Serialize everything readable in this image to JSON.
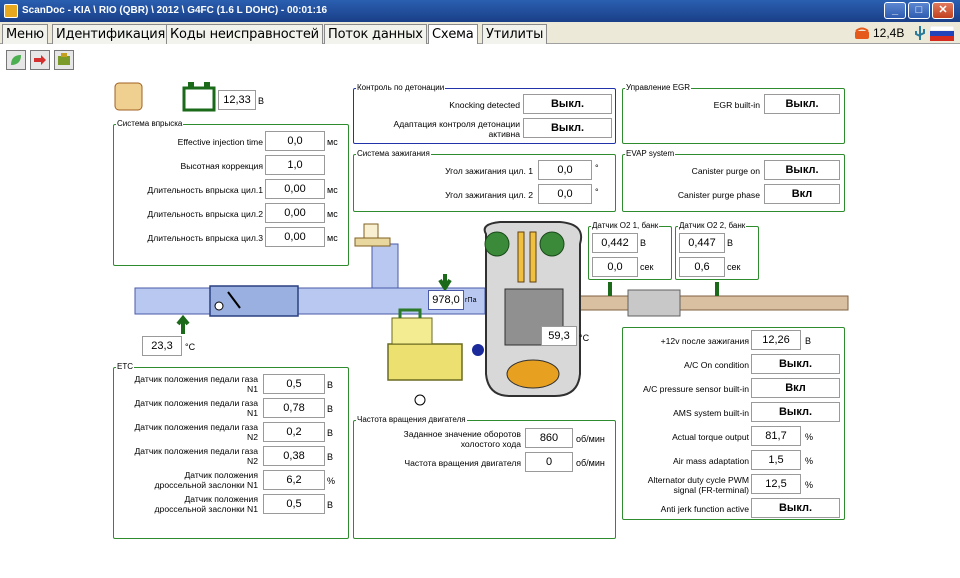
{
  "window": {
    "title": "ScanDoc - KIA \\ RIO (QBR) \\ 2012 \\ G4FC (1.6 L DOHC) - 00:01:16",
    "min": "_",
    "max": "□",
    "close": "✕"
  },
  "tabs": [
    "Меню",
    "Идентификация",
    "Коды неисправностей",
    "Поток данных",
    "Схема",
    "Утилиты"
  ],
  "status": {
    "voltage": "12,4В"
  },
  "battery": {
    "value": "12,33",
    "unit": "В"
  },
  "injection": {
    "title": "Система впрыска",
    "rows": [
      {
        "label": "Effective injection time",
        "value": "0,0",
        "unit": "мс"
      },
      {
        "label": "Высотная коррекция",
        "value": "1,0",
        "unit": ""
      },
      {
        "label": "Длительность впрыска цил.1",
        "value": "0,00",
        "unit": "мс"
      },
      {
        "label": "Длительность впрыска цил.2",
        "value": "0,00",
        "unit": "мс"
      },
      {
        "label": "Длительность впрыска цил.3",
        "value": "0,00",
        "unit": "мс"
      }
    ]
  },
  "knock": {
    "title": "Контроль по детонации",
    "rows": [
      {
        "label": "Knocking detected",
        "value": "Выкл."
      },
      {
        "label1": "Адаптация контроля детонации",
        "label2": "активна",
        "value": "Выкл."
      }
    ]
  },
  "ignition": {
    "title": "Система зажигания",
    "rows": [
      {
        "label": "Угол зажигания цил. 1",
        "value": "0,0",
        "unit": "°"
      },
      {
        "label": "Угол зажигания цил. 2",
        "value": "0,0",
        "unit": "°"
      }
    ]
  },
  "egr": {
    "title": "Управление EGR",
    "label": "EGR built-in",
    "value": "Выкл."
  },
  "evap": {
    "title": "EVAP system",
    "rows": [
      {
        "label": "Canister purge on",
        "value": "Выкл."
      },
      {
        "label": "Canister purge phase",
        "value": "Вкл"
      }
    ]
  },
  "o2_1": {
    "title": "Датчик O2 1, банк",
    "volt": "0,442",
    "volt_unit": "В",
    "time": "0,0",
    "time_unit": "сек"
  },
  "o2_2": {
    "title": "Датчик O2 2, банк",
    "volt": "0,447",
    "volt_unit": "В",
    "time": "0,6",
    "time_unit": "сек"
  },
  "intake_temp": {
    "value": "23,3",
    "unit": "°C"
  },
  "map_pressure": {
    "value": "978,0",
    "unit": "гПа"
  },
  "coolant": {
    "value": "59,3",
    "unit": "°C"
  },
  "etc": {
    "title": "ETC",
    "rows": [
      {
        "label1": "Датчик положения педали газа",
        "label2": "N1",
        "value": "0,5",
        "unit": "В"
      },
      {
        "label1": "Датчик положения педали газа",
        "label2": "N1",
        "value": "0,78",
        "unit": "В"
      },
      {
        "label1": "Датчик положения педали газа",
        "label2": "N2",
        "value": "0,2",
        "unit": "В"
      },
      {
        "label1": "Датчик положения педали газа",
        "label2": "N2",
        "value": "0,38",
        "unit": "В"
      },
      {
        "label1": "Датчик положения",
        "label2": "дроссельной заслонки N1",
        "value": "6,2",
        "unit": "%"
      },
      {
        "label1": "Датчик положения",
        "label2": "дроссельной заслонки N1",
        "value": "0,5",
        "unit": "В"
      }
    ]
  },
  "rpm": {
    "title": "Частота вращения двигателя",
    "rows": [
      {
        "label1": "Заданное значение оборотов",
        "label2": "холостого хода",
        "value": "860",
        "unit": "об/мин"
      },
      {
        "label1": "Частота вращения двигателя",
        "label2": "",
        "value": "0",
        "unit": "об/мин"
      }
    ]
  },
  "misc": {
    "rows": [
      {
        "label": "+12v после зажигания",
        "value": "12,26",
        "unit": "В"
      },
      {
        "label": "A/C On condition",
        "value": "Выкл.",
        "unit": ""
      },
      {
        "label": "A/C pressure sensor built-in",
        "value": "Вкл",
        "unit": ""
      },
      {
        "label": "AMS system built-in",
        "value": "Выкл.",
        "unit": ""
      },
      {
        "label": "Actual torque output",
        "value": "81,7",
        "unit": "%"
      },
      {
        "label": "Air mass adaptation",
        "value": "1,5",
        "unit": "%"
      },
      {
        "label1": "Alternator duty cycle PWM",
        "label2": "signal (FR-terminal)",
        "value": "12,5",
        "unit": "%"
      },
      {
        "label": "Anti jerk function active",
        "value": "Выкл.",
        "unit": ""
      }
    ]
  },
  "colors": {
    "panel_border": "#2e8b2e",
    "pipe_intake": "#b8c8f0",
    "pipe_exhaust": "#d8c0a0",
    "titlebar": "#1f4c9a"
  }
}
